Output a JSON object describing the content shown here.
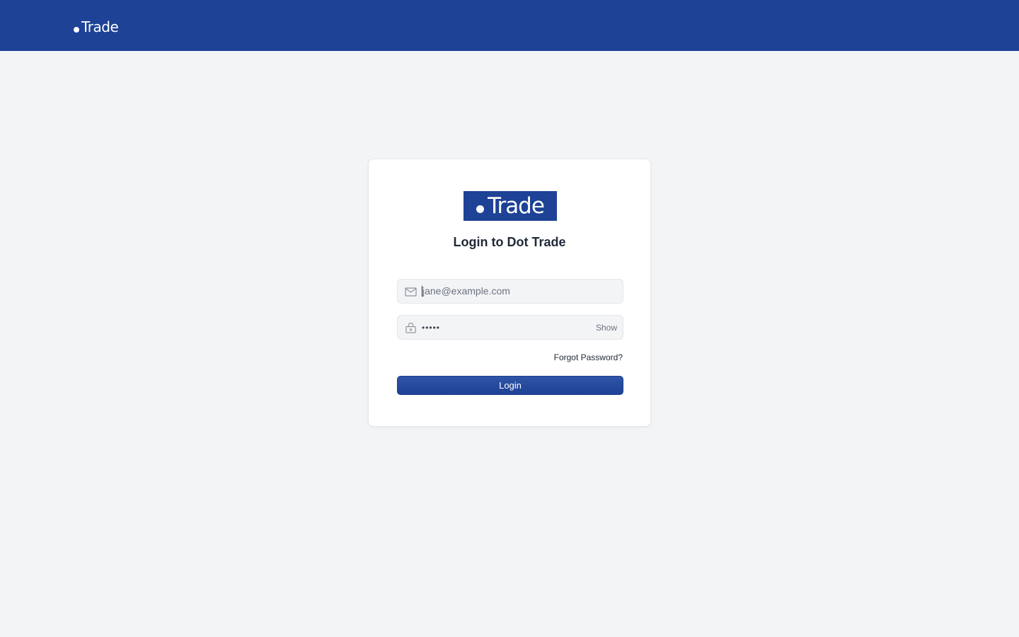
{
  "header": {
    "logo_text": "Trade"
  },
  "login": {
    "logo_text": "Trade",
    "title": "Login to Dot Trade",
    "email_placeholder": "jane@example.com",
    "email_icon": "envelope-icon",
    "password_value": "•••••",
    "password_icon": "lock-icon",
    "show_label": "Show",
    "forgot_label": "Forgot Password?",
    "login_label": "Login"
  },
  "colors": {
    "brand": "#1d4296",
    "background": "#f3f4f6"
  }
}
